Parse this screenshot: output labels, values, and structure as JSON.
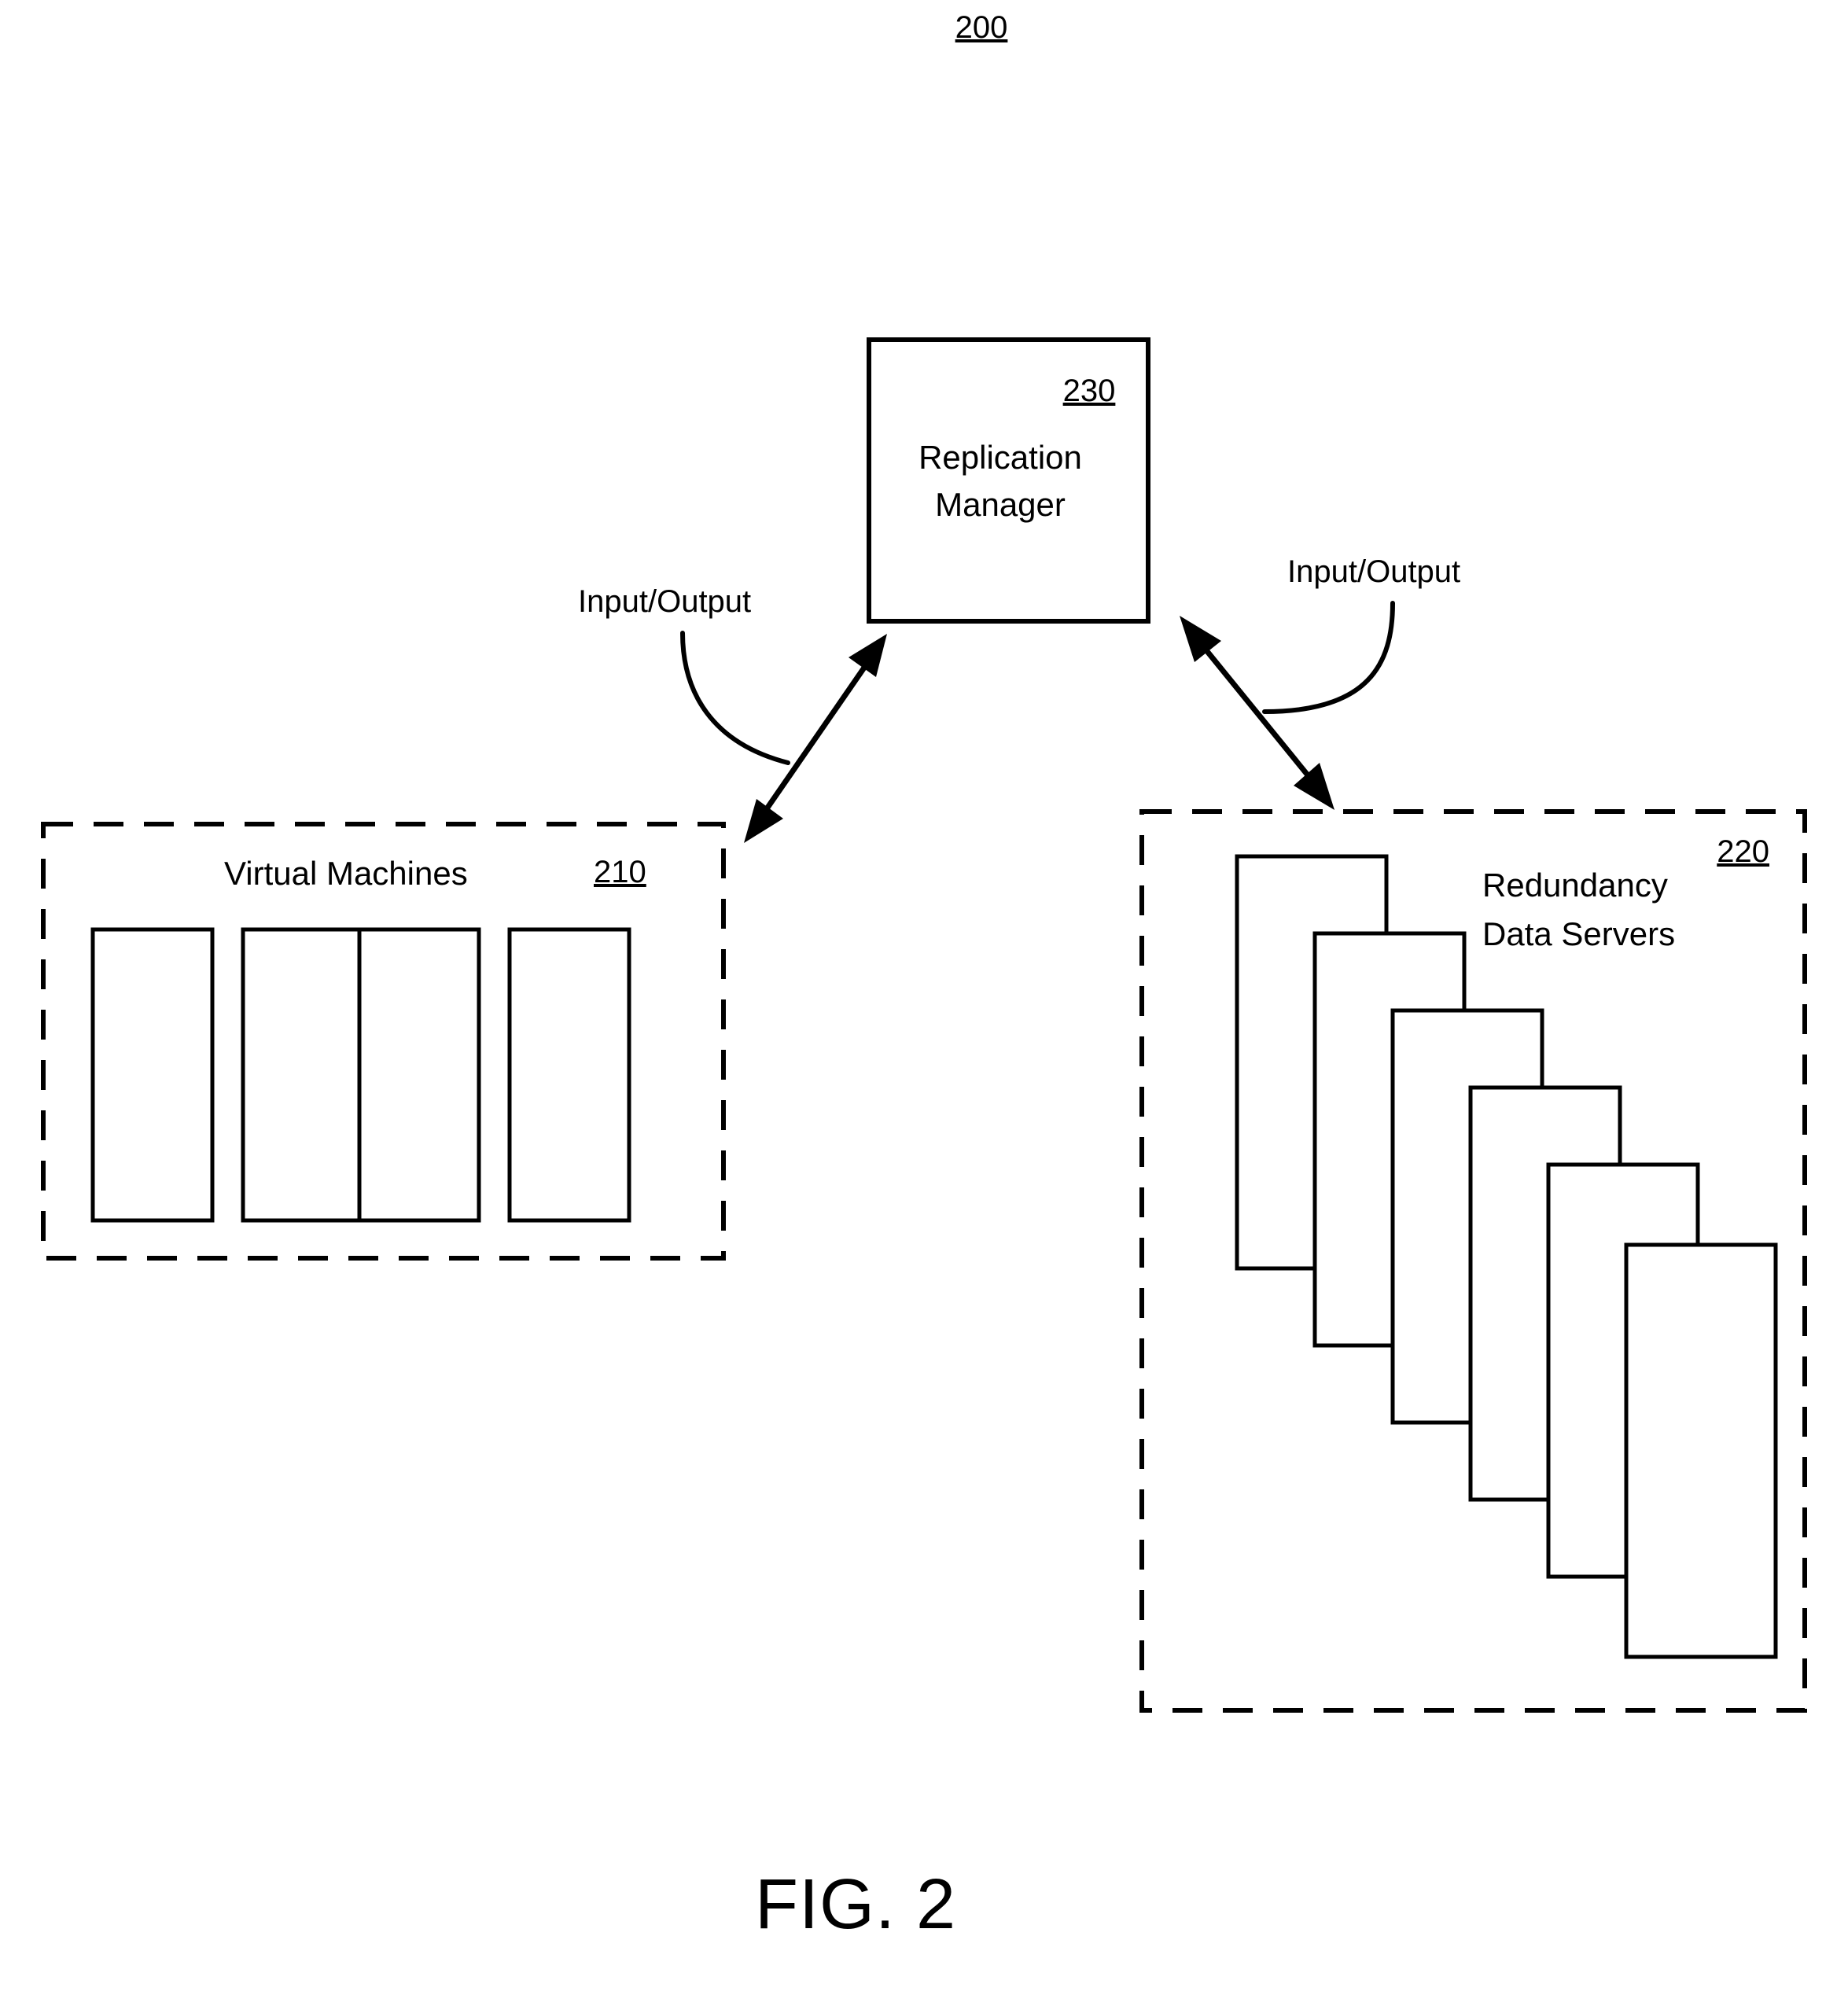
{
  "figure": {
    "top_reference": "200",
    "caption": "FIG. 2"
  },
  "replication_manager": {
    "reference": "230",
    "title_line1": "Replication",
    "title_line2": "Manager"
  },
  "virtual_machines": {
    "reference": "210",
    "label": "Virtual Machines",
    "machine_count": 4,
    "machine_names": [
      "virtual-machine-1",
      "virtual-machine-2",
      "virtual-machine-3",
      "virtual-machine-4"
    ]
  },
  "redundancy_data_servers": {
    "reference": "220",
    "label_line1": "Redundancy",
    "label_line2": "Data Servers",
    "server_count": 6,
    "server_names": [
      "data-server-1",
      "data-server-2",
      "data-server-3",
      "data-server-4",
      "data-server-5",
      "data-server-6"
    ]
  },
  "connections": {
    "left_label": "Input/Output",
    "right_label": "Input/Output"
  },
  "colors": {
    "line": "#000000",
    "background": "#ffffff",
    "text": "#000000"
  }
}
